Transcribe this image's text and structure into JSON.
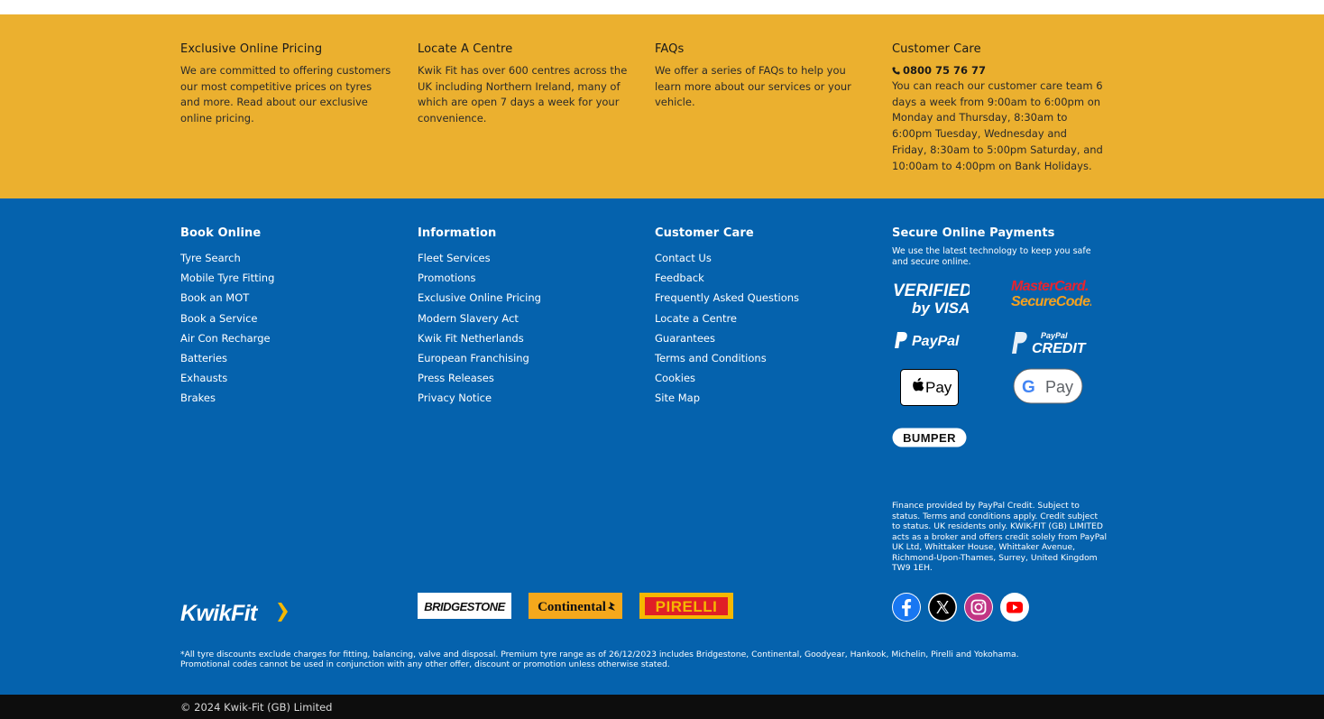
{
  "info_bar": {
    "columns": [
      {
        "title": "Exclusive Online Pricing",
        "text": "We are committed to offering customers our most competitive prices on tyres and more. Read about our exclusive online pricing."
      },
      {
        "title": "Locate A Centre",
        "text": "Kwik Fit has over 600 centres across the UK including Northern Ireland, many of which are open 7 days a week for your convenience."
      },
      {
        "title": "FAQs",
        "text": "We offer a series of FAQs to help you learn more about our services or your vehicle."
      },
      {
        "title": "Customer Care",
        "phone": "0800 75 76 77",
        "text": "You can reach our customer care team 6 days a week from 9:00am to 6:00pm on Monday and Thursday, 8:30am to 6:00pm Tuesday, Wednesday and Friday, 8:30am to 5:00pm Saturday, and 10:00am to 4:00pm on Bank Holidays."
      }
    ]
  },
  "footer": {
    "book_online": {
      "title": "Book Online",
      "links": [
        "Tyre Search",
        "Mobile Tyre Fitting",
        "Book an MOT",
        "Book a Service",
        "Air Con Recharge",
        "Batteries",
        "Exhausts",
        "Brakes"
      ]
    },
    "information": {
      "title": "Information",
      "links": [
        "Fleet Services",
        "Promotions",
        "Exclusive Online Pricing",
        "Modern Slavery Act",
        "Kwik Fit Netherlands",
        "European Franchising",
        "Press Releases",
        "Privacy Notice"
      ]
    },
    "customer_care": {
      "title": "Customer Care",
      "links": [
        "Contact Us",
        "Feedback",
        "Frequently Asked Questions",
        "Locate a Centre",
        "Guarantees",
        "Terms and Conditions",
        "Cookies",
        "Site Map"
      ]
    },
    "secure": {
      "title": "Secure Online Payments",
      "text": "We use the latest technology to keep you safe and secure online.",
      "logos": {
        "visa_top": "VERIFIED",
        "visa_bottom": "by VISA",
        "mc_top": "MasterCard.",
        "mc_bottom": "SecureCode.",
        "paypal": "PayPal",
        "paypal_credit_top": "PayPal",
        "paypal_credit_bottom": "CREDIT",
        "apple_pay": "Pay",
        "google_pay": "Pay",
        "bumper": "BUMPER"
      },
      "finance": "Finance provided by PayPal Credit. Subject to status. Terms and conditions apply. Credit subject to status. UK residents only. KWIK-FIT (GB) LIMITED acts as a broker and offers credit solely from PayPal UK Ltd, Whittaker House, Whittaker Avenue, Richmond-Upon-Thames, Surrey, United Kingdom TW9 1EH."
    },
    "logo_text": "KwikFit",
    "brands": [
      "BRIDGESTONE",
      "Continental",
      "PIRELLI"
    ],
    "social": [
      "facebook",
      "x",
      "instagram",
      "youtube"
    ],
    "disclaimer_1": "*All tyre discounts exclude charges for fitting, balancing, valve and disposal. Premium tyre range as of 26/12/2023 includes Bridgestone, Continental, Goodyear, Hankook, Michelin, Pirelli and Yokohama.",
    "disclaimer_2": "Promotional codes cannot be used in conjunction with any other offer, discount or promotion unless otherwise stated."
  },
  "bottom_bar": {
    "copyright": "© 2024 Kwik-Fit (GB) Limited"
  },
  "colors": {
    "yellow": "#ebb02f",
    "blue": "#0562ad",
    "dark": "#0d0d0d"
  }
}
